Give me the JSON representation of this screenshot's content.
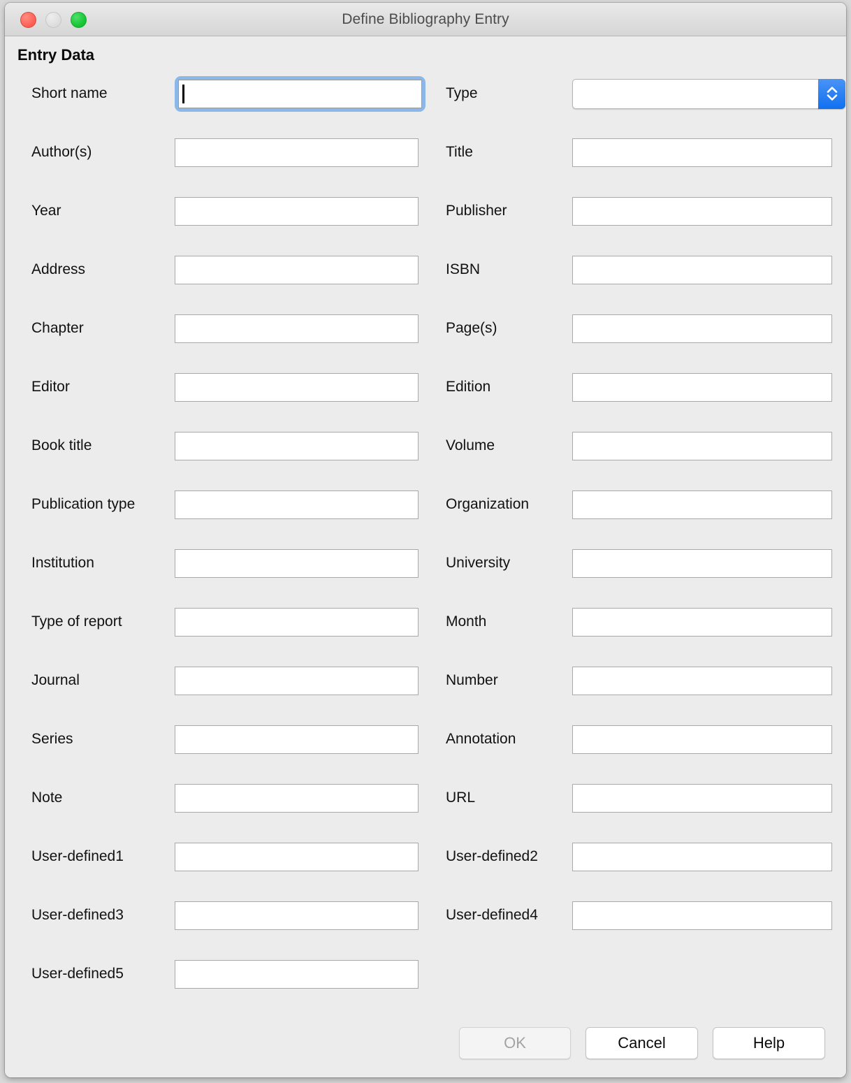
{
  "window": {
    "title": "Define Bibliography Entry",
    "traffic_lights": {
      "close": "close-button",
      "minimize": "minimize-button",
      "zoom": "zoom-button"
    }
  },
  "section": {
    "heading": "Entry Data"
  },
  "rows": [
    {
      "left": {
        "label": "Short name",
        "value": "",
        "placeholder": "",
        "focused": true
      },
      "right": {
        "label": "Type",
        "value": "",
        "placeholder": "",
        "control": "combo"
      }
    },
    {
      "left": {
        "label": "Author(s)",
        "value": "",
        "placeholder": ""
      },
      "right": {
        "label": "Title",
        "value": "",
        "placeholder": ""
      }
    },
    {
      "left": {
        "label": "Year",
        "value": "",
        "placeholder": ""
      },
      "right": {
        "label": "Publisher",
        "value": "",
        "placeholder": ""
      }
    },
    {
      "left": {
        "label": "Address",
        "value": "",
        "placeholder": ""
      },
      "right": {
        "label": "ISBN",
        "value": "",
        "placeholder": ""
      }
    },
    {
      "left": {
        "label": "Chapter",
        "value": "",
        "placeholder": ""
      },
      "right": {
        "label": "Page(s)",
        "value": "",
        "placeholder": ""
      }
    },
    {
      "left": {
        "label": "Editor",
        "value": "",
        "placeholder": ""
      },
      "right": {
        "label": "Edition",
        "value": "",
        "placeholder": ""
      }
    },
    {
      "left": {
        "label": "Book title",
        "value": "",
        "placeholder": ""
      },
      "right": {
        "label": "Volume",
        "value": "",
        "placeholder": ""
      }
    },
    {
      "left": {
        "label": "Publication type",
        "value": "",
        "placeholder": ""
      },
      "right": {
        "label": "Organization",
        "value": "",
        "placeholder": ""
      }
    },
    {
      "left": {
        "label": "Institution",
        "value": "",
        "placeholder": ""
      },
      "right": {
        "label": "University",
        "value": "",
        "placeholder": ""
      }
    },
    {
      "left": {
        "label": "Type of report",
        "value": "",
        "placeholder": ""
      },
      "right": {
        "label": "Month",
        "value": "",
        "placeholder": ""
      }
    },
    {
      "left": {
        "label": "Journal",
        "value": "",
        "placeholder": ""
      },
      "right": {
        "label": "Number",
        "value": "",
        "placeholder": ""
      }
    },
    {
      "left": {
        "label": "Series",
        "value": "",
        "placeholder": ""
      },
      "right": {
        "label": "Annotation",
        "value": "",
        "placeholder": ""
      }
    },
    {
      "left": {
        "label": "Note",
        "value": "",
        "placeholder": ""
      },
      "right": {
        "label": "URL",
        "value": "",
        "placeholder": ""
      }
    },
    {
      "left": {
        "label": "User-defined1",
        "value": "",
        "placeholder": ""
      },
      "right": {
        "label": "User-defined2",
        "value": "",
        "placeholder": ""
      }
    },
    {
      "left": {
        "label": "User-defined3",
        "value": "",
        "placeholder": ""
      },
      "right": {
        "label": "User-defined4",
        "value": "",
        "placeholder": ""
      }
    },
    {
      "left": {
        "label": "User-defined5",
        "value": "",
        "placeholder": ""
      },
      "right": null
    }
  ],
  "footer": {
    "ok_label": "OK",
    "ok_disabled": true,
    "cancel_label": "Cancel",
    "help_label": "Help"
  },
  "colors": {
    "focus_ring": "#8bb8e8",
    "combo_button": "#1170f0",
    "window_background": "#ececec",
    "titlebar_top": "#e9e9e9",
    "titlebar_bottom": "#d6d6d6",
    "close_red": "#fc5c52",
    "minimize_grey": "#dcdcdc",
    "zoom_green": "#12c22e",
    "disabled_text": "#a3a3a3"
  }
}
